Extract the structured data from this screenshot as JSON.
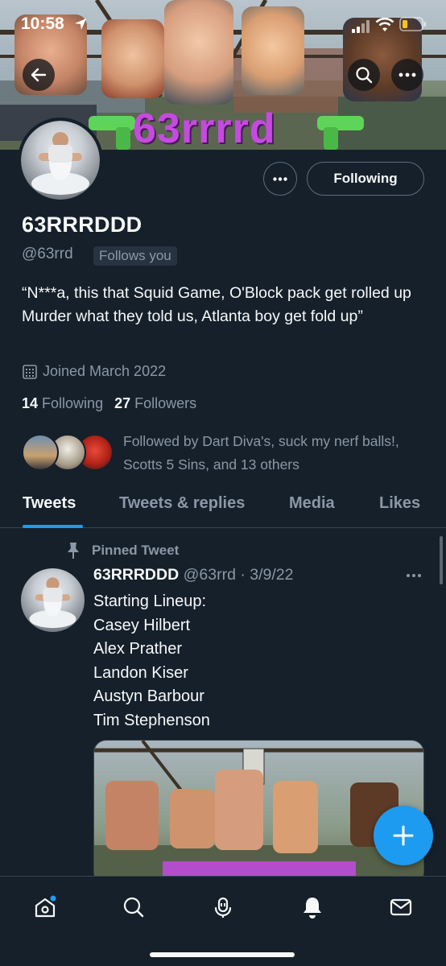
{
  "status_bar": {
    "time": "10:58"
  },
  "banner": {
    "text": "63rrrrd"
  },
  "profile": {
    "name": "63RRRDDD",
    "handle": "@63rrd",
    "follows_you": "Follows you",
    "following_button": "Following",
    "bio": "“N***a, this that Squid Game, O'Block pack get rolled up Murder what they told us, Atlanta boy get fold up”",
    "joined": "Joined March 2022",
    "following_count": "14",
    "following_label": "Following",
    "followers_count": "27",
    "followers_label": "Followers",
    "followed_by": "Followed by Dart Diva's, suck my nerf balls!, Scotts 5 Sins, and 13 others"
  },
  "tabs": [
    {
      "label": "Tweets",
      "active": true
    },
    {
      "label": "Tweets & replies",
      "active": false
    },
    {
      "label": "Media",
      "active": false
    },
    {
      "label": "Likes",
      "active": false
    }
  ],
  "pinned_tweet": {
    "pinned_label": "Pinned Tweet",
    "author_name": "63RRRDDD",
    "author_handle_date": "@63rrd · 3/9/22",
    "lines": [
      "Starting Lineup:",
      "Casey Hilbert",
      "Alex Prather",
      "Landon Kiser",
      "Austyn Barbour",
      "Tim Stephenson"
    ]
  },
  "colors": {
    "background": "#15202b",
    "accent": "#1d9bf0",
    "muted": "#8b98a5",
    "banner_text": "#c64ae0"
  }
}
